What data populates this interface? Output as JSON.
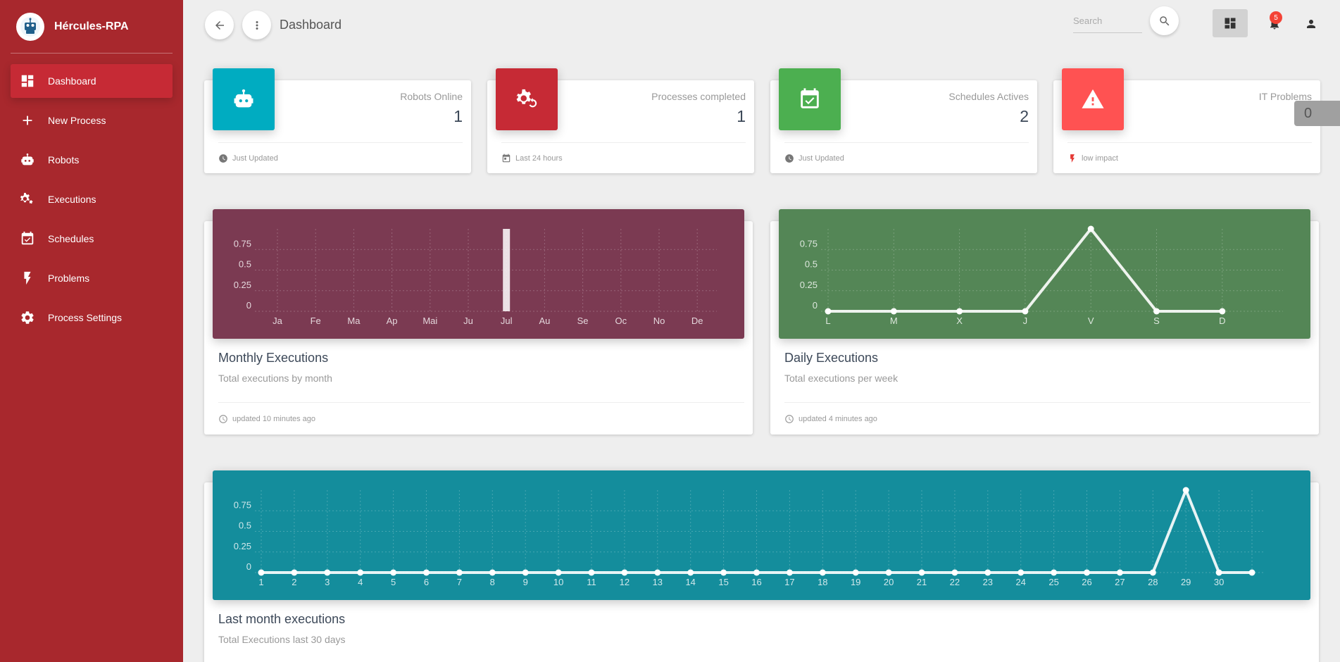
{
  "app": {
    "name": "Hércules-RPA"
  },
  "sidebar": {
    "items": [
      {
        "label": "Dashboard",
        "icon": "dashboard-icon",
        "active": true
      },
      {
        "label": "New Process",
        "icon": "plus-icon"
      },
      {
        "label": "Robots",
        "icon": "robot-icon"
      },
      {
        "label": "Executions",
        "icon": "gears-icon"
      },
      {
        "label": "Schedules",
        "icon": "calendar-check-icon"
      },
      {
        "label": "Problems",
        "icon": "bolt-icon"
      },
      {
        "label": "Process Settings",
        "icon": "gear-icon"
      }
    ]
  },
  "header": {
    "title": "Dashboard",
    "search_placeholder": "Search",
    "notification_count": "5"
  },
  "stats": [
    {
      "label": "Robots Online",
      "value": "1",
      "footer": "Just Updated",
      "color": "#00acc1",
      "icon": "robot-icon",
      "footer_icon": "clock-icon"
    },
    {
      "label": "Processes completed",
      "value": "1",
      "footer": "Last 24 hours",
      "color": "#c62a35",
      "icon": "gear-sync-icon",
      "footer_icon": "calendar-icon"
    },
    {
      "label": "Schedules Actives",
      "value": "2",
      "footer": "Just Updated",
      "color": "#4caf50",
      "icon": "calendar-check-icon",
      "footer_icon": "clock-icon"
    },
    {
      "label": "IT Problems",
      "value": "0",
      "footer": "low impact",
      "color": "#ff5252",
      "icon": "warning-icon",
      "footer_icon": "bolt-icon"
    }
  ],
  "overflow_value": "0",
  "charts": [
    {
      "title": "Monthly Executions",
      "subtitle": "Total executions by month",
      "footer": "updated 10 minutes ago",
      "color": "#7b3a52"
    },
    {
      "title": "Daily Executions",
      "subtitle": "Total executions per week",
      "footer": "updated 4 minutes ago",
      "color": "#548656"
    },
    {
      "title": "Last month executions",
      "subtitle": "Total Executions last 30 days",
      "footer": "",
      "color": "#148d9c"
    }
  ],
  "chart_data": [
    {
      "type": "bar",
      "categories": [
        "Ja",
        "Fe",
        "Ma",
        "Ap",
        "Mai",
        "Ju",
        "Jul",
        "Au",
        "Se",
        "Oc",
        "No",
        "De"
      ],
      "values": [
        0,
        0,
        0,
        0,
        0,
        0,
        1,
        0,
        0,
        0,
        0,
        0
      ],
      "yticks": [
        "0",
        "0.25",
        "0.5",
        "0.75"
      ],
      "ylim": [
        0,
        1
      ],
      "grid": true
    },
    {
      "type": "line",
      "categories": [
        "L",
        "M",
        "X",
        "J",
        "V",
        "S",
        "D"
      ],
      "values": [
        0,
        0,
        0,
        0,
        1,
        0,
        0
      ],
      "yticks": [
        "0",
        "0.25",
        "0.5",
        "0.75"
      ],
      "ylim": [
        0,
        1
      ],
      "grid": true
    },
    {
      "type": "line",
      "categories": [
        "1",
        "2",
        "3",
        "4",
        "5",
        "6",
        "7",
        "8",
        "9",
        "10",
        "11",
        "12",
        "13",
        "14",
        "15",
        "16",
        "17",
        "18",
        "19",
        "20",
        "21",
        "22",
        "23",
        "24",
        "25",
        "26",
        "27",
        "28",
        "29",
        "30",
        ""
      ],
      "values": [
        0,
        0,
        0,
        0,
        0,
        0,
        0,
        0,
        0,
        0,
        0,
        0,
        0,
        0,
        0,
        0,
        0,
        0,
        0,
        0,
        0,
        0,
        0,
        0,
        0,
        0,
        0,
        0,
        1,
        0,
        0
      ],
      "yticks": [
        "0",
        "0.25",
        "0.5",
        "0.75"
      ],
      "ylim": [
        0,
        1
      ],
      "grid": true
    }
  ]
}
